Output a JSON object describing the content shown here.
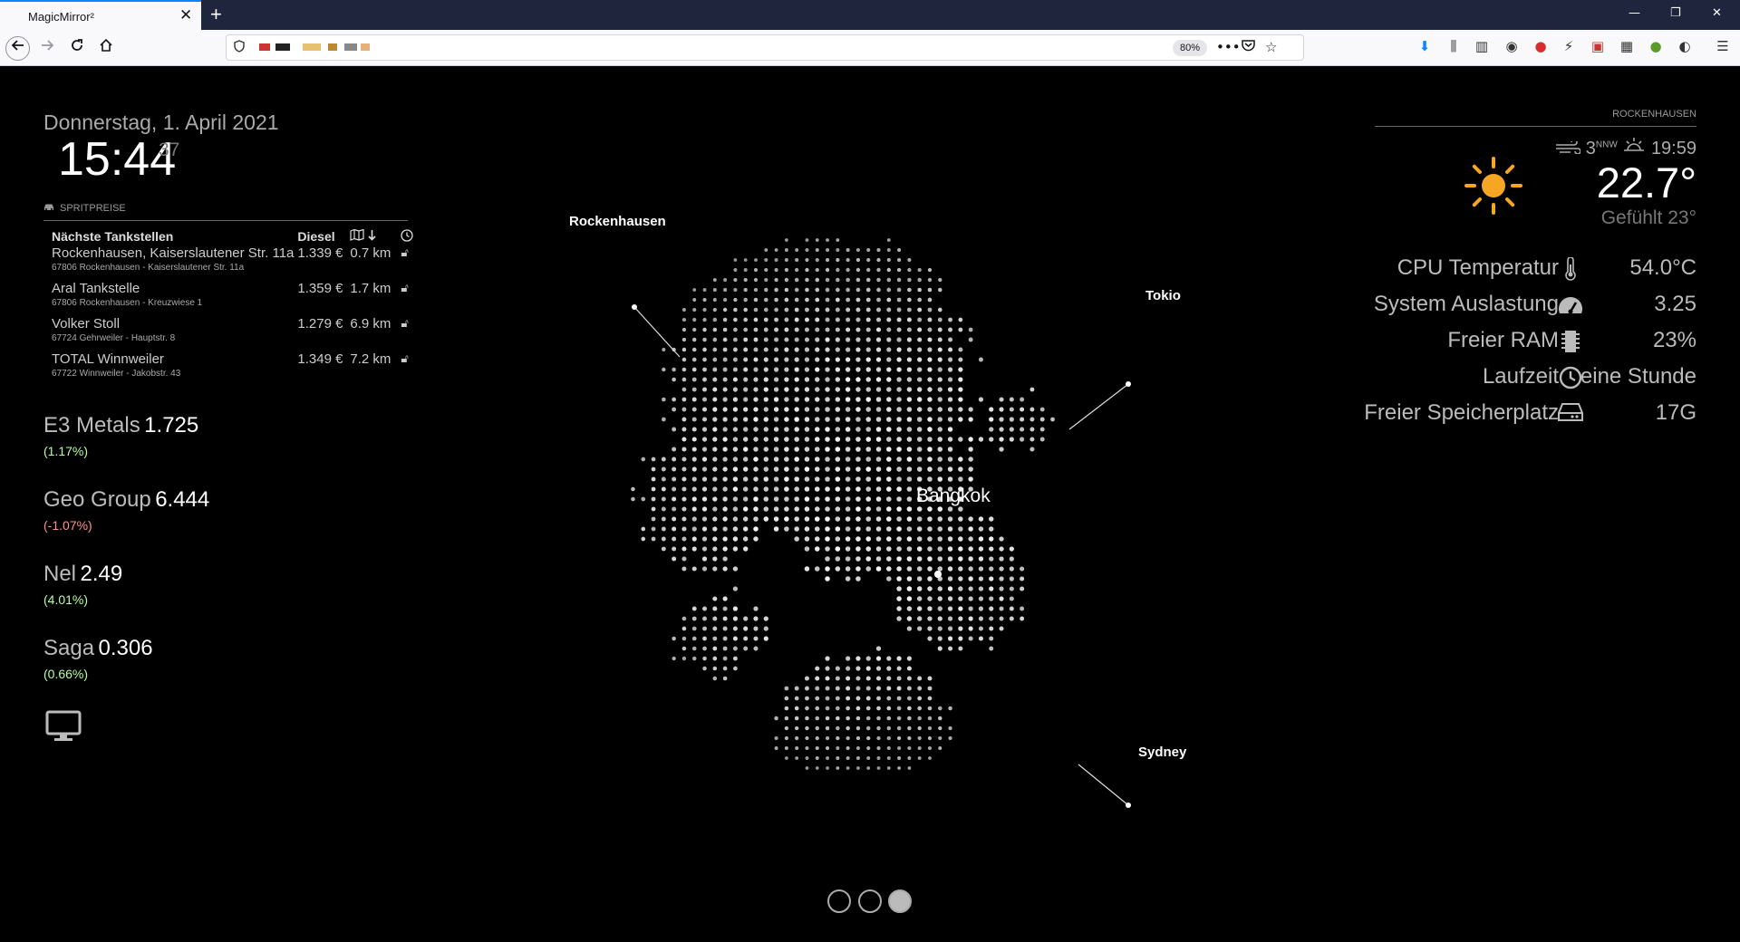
{
  "browser": {
    "tab_title": "MagicMirror²",
    "tab_close": "✕",
    "new_tab": "+",
    "zoom": "80%",
    "window_controls": {
      "minimize": "—",
      "restore": "❐",
      "close": "✕"
    }
  },
  "clock": {
    "date": "Donnerstag, 1. April 2021",
    "time": "15:44",
    "seconds": "37"
  },
  "fuel": {
    "header": "Spritpreise",
    "col_name": "Nächste Tankstellen",
    "col_fuel": "Diesel",
    "stations": [
      {
        "name": "Rockenhausen, Kaiserslautener Str. 11a",
        "price": "1.339 €",
        "distance": "0.7 km",
        "address": "67806 Rockenhausen - Kaiserslautener Str. 11a"
      },
      {
        "name": "Aral Tankstelle",
        "price": "1.359 €",
        "distance": "1.7 km",
        "address": "67806 Rockenhausen - Kreuzwiese 1"
      },
      {
        "name": "Volker Stoll",
        "price": "1.279 €",
        "distance": "6.9 km",
        "address": "67724 Gehrweiler - Hauptstr. 8"
      },
      {
        "name": "TOTAL Winnweiler",
        "price": "1.349 €",
        "distance": "7.2 km",
        "address": "67722 Winnweiler - Jakobstr. 43"
      }
    ]
  },
  "stocks": [
    {
      "name": "E3 Metals",
      "price": "1.725",
      "change": "(1.17%)",
      "direction": "up"
    },
    {
      "name": "Geo Group",
      "price": "6.444",
      "change": "(-1.07%)",
      "direction": "down"
    },
    {
      "name": "Nel",
      "price": "2.49",
      "change": "(4.01%)",
      "direction": "up"
    },
    {
      "name": "Saga",
      "price": "0.306",
      "change": "(0.66%)",
      "direction": "up"
    }
  ],
  "globe": {
    "labels": {
      "rockenhausen": "Rockenhausen",
      "tokio": "Tokio",
      "bangkok": "Bangkok",
      "sydney": "Sydney"
    }
  },
  "weather": {
    "location": "Rockenhausen",
    "wind_speed": "3",
    "wind_dir": "NNW",
    "sunset": "19:59",
    "temperature": "22.7°",
    "feels_like": "Gefühlt 23°"
  },
  "system": [
    {
      "label": "CPU Temperatur",
      "value": "54.0°C",
      "icon": "thermometer-icon"
    },
    {
      "label": "System Auslastung",
      "value": "3.25",
      "icon": "speedometer-icon"
    },
    {
      "label": "Freier RAM",
      "value": "23%",
      "icon": "memory-icon"
    },
    {
      "label": "Laufzeit",
      "value": "eine Stunde",
      "icon": "clock-icon"
    },
    {
      "label": "Freier Speicherplatz",
      "value": "17G",
      "icon": "hdd-icon"
    }
  ],
  "pager": {
    "pages": 3,
    "active": 3
  },
  "colors": {
    "up": "#b6ff9e",
    "down": "#ff8f8f",
    "sun": "#f5a623",
    "tab_accent": "#0a84ff"
  }
}
